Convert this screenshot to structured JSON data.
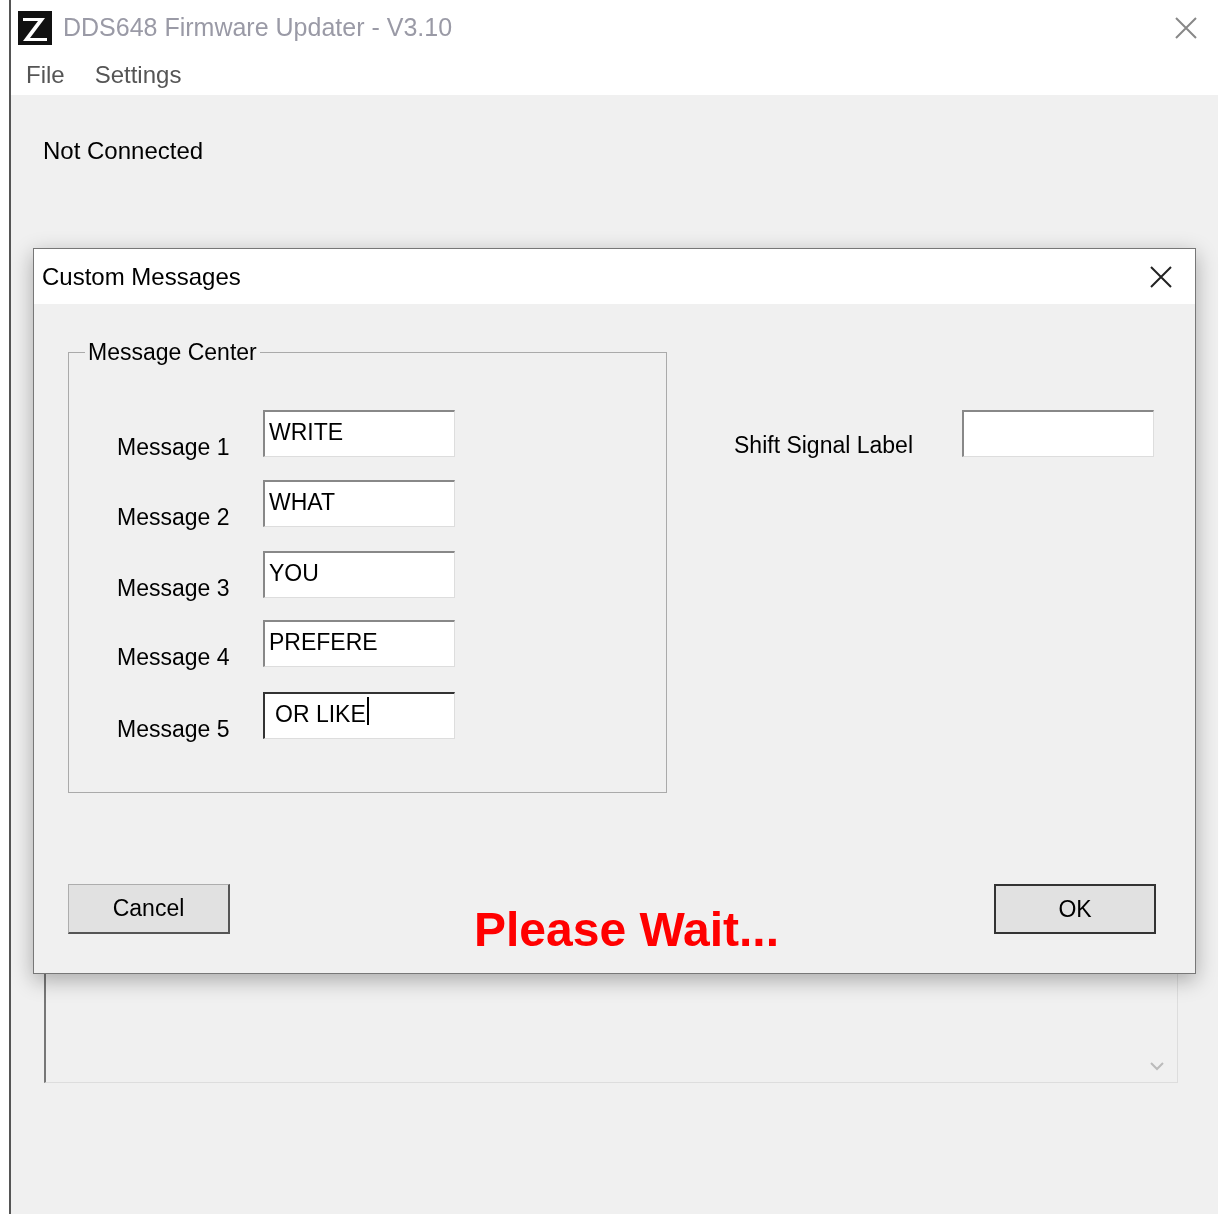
{
  "window": {
    "title": "DDS648 Firmware Updater - V3.10"
  },
  "menu": [
    "File",
    "Settings"
  ],
  "status": "Not Connected",
  "dialog": {
    "title": "Custom Messages",
    "group_title": "Message Center",
    "messages": [
      {
        "label": "Message 1",
        "value": "WRITE",
        "focused": false
      },
      {
        "label": "Message 2",
        "value": "WHAT",
        "focused": false
      },
      {
        "label": "Message 3",
        "value": "YOU",
        "focused": false
      },
      {
        "label": "Message 4",
        "value": "PREFERE",
        "focused": false
      },
      {
        "label": "Message 5",
        "value": "OR LIKE",
        "focused": true
      }
    ],
    "shift_signal": {
      "label": "Shift Signal Label"
    },
    "buttons": {
      "cancel": "Cancel",
      "ok": "OK"
    },
    "notice": "Please Wait..."
  }
}
